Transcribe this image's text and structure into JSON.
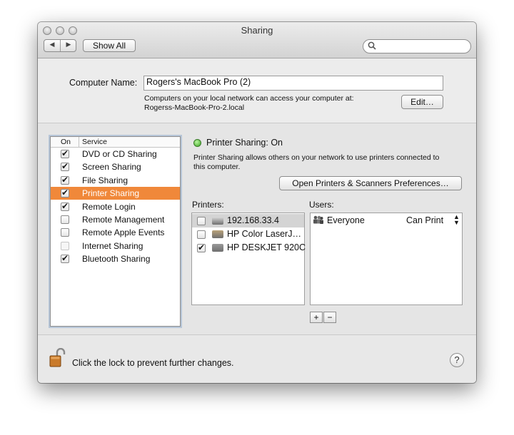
{
  "window": {
    "title": "Sharing"
  },
  "toolbar": {
    "back_glyph": "◀",
    "forward_glyph": "▶",
    "show_all_label": "Show All",
    "search_placeholder": ""
  },
  "computer": {
    "name_label": "Computer Name:",
    "name_value": "Rogers's MacBook Pro (2)",
    "info_line1": "Computers on your local network can access your computer at:",
    "info_line2": "Rogerss-MacBook-Pro-2.local",
    "edit_label": "Edit…"
  },
  "services": {
    "header_on": "On",
    "header_service": "Service",
    "items": [
      {
        "label": "DVD or CD Sharing",
        "checked": true,
        "selected": false,
        "enabled": true
      },
      {
        "label": "Screen Sharing",
        "checked": true,
        "selected": false,
        "enabled": true
      },
      {
        "label": "File Sharing",
        "checked": true,
        "selected": false,
        "enabled": true
      },
      {
        "label": "Printer Sharing",
        "checked": true,
        "selected": true,
        "enabled": true
      },
      {
        "label": "Remote Login",
        "checked": true,
        "selected": false,
        "enabled": true
      },
      {
        "label": "Remote Management",
        "checked": false,
        "selected": false,
        "enabled": true
      },
      {
        "label": "Remote Apple Events",
        "checked": false,
        "selected": false,
        "enabled": true
      },
      {
        "label": "Internet Sharing",
        "checked": false,
        "selected": false,
        "enabled": false
      },
      {
        "label": "Bluetooth Sharing",
        "checked": true,
        "selected": false,
        "enabled": true
      }
    ]
  },
  "detail": {
    "status_text": "Printer Sharing: On",
    "status_color": "#3aa51f",
    "description_line1": "Printer Sharing allows others on your network to use printers connected to",
    "description_line2": "this computer.",
    "open_prefs_label": "Open Printers & Scanners Preferences…",
    "printers_label": "Printers:",
    "users_label": "Users:",
    "printers": [
      {
        "name": "192.168.33.4",
        "checked": false,
        "selected": true,
        "icon": "network-printer-icon"
      },
      {
        "name": "HP Color LaserJ…",
        "checked": false,
        "selected": false,
        "icon": "laser-printer-icon"
      },
      {
        "name": "HP DESKJET 920C",
        "checked": true,
        "selected": false,
        "icon": "inkjet-printer-icon"
      }
    ],
    "users": [
      {
        "name": "Everyone",
        "permission": "Can Print",
        "icon": "group-icon"
      }
    ],
    "add_label": "+",
    "remove_label": "−"
  },
  "footer": {
    "lock_text": "Click the lock to prevent further changes.",
    "help_label": "?",
    "lock_icon": "unlocked-padlock-icon"
  },
  "colors": {
    "selection": "#f0883a",
    "status_green": "#3aa51f"
  }
}
